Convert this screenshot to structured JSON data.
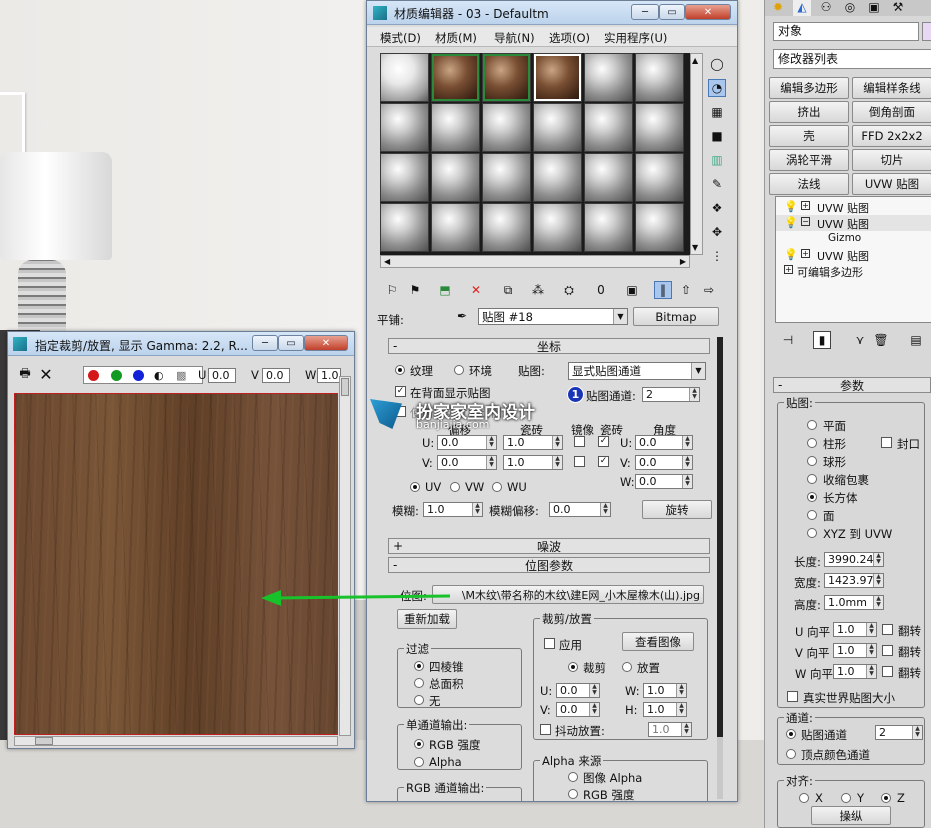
{
  "material_editor": {
    "title": "材质编辑器 - 03 - Defaultm",
    "menu": [
      "模式(D)",
      "材质(M)",
      "导航(N)",
      "选项(O)",
      "实用程序(U)"
    ],
    "tiling_label": "平铺:",
    "map_name": "贴图 #18",
    "map_type_button": "Bitmap",
    "coords": {
      "header": "坐标",
      "texture_label": "纹理",
      "environ_label": "环境",
      "mapping_label": "贴图:",
      "mapping_value": "显式贴图通道",
      "show_on_back": "在背面显示贴图",
      "map_channel_label": "贴图通道:",
      "map_channel_value": "2",
      "use_real_world": "使用真实世界比例",
      "offset_label": "偏移",
      "tiling_col": "瓷砖",
      "mirror_col": "镜像",
      "tile_col": "瓷砖",
      "angle_col": "角度",
      "u_label": "U:",
      "v_label": "V:",
      "w_label": "W:",
      "u_offset": "0.0",
      "v_offset": "0.0",
      "u_tiling": "1.0",
      "v_tiling": "1.0",
      "u_angle": "0.0",
      "v_angle": "0.0",
      "w_angle": "0.0",
      "uv": "UV",
      "vw": "VW",
      "wu": "WU",
      "blur_label": "模糊:",
      "blur_value": "1.0",
      "blur_offset_label": "模糊偏移:",
      "blur_offset_value": "0.0",
      "rotate_button": "旋转"
    },
    "noise_header": "噪波",
    "bitmap_params": {
      "header": "位图参数",
      "bitmap_label": "位图:",
      "bitmap_path": "\\M木纹\\带名称的木纹\\建E网_小木屋橡木(山).jpg",
      "reload_button": "重新加载",
      "crop_group": "裁剪/放置",
      "apply_label": "应用",
      "view_image_button": "查看图像",
      "crop_label": "裁剪",
      "place_label": "放置",
      "u_value": "0.0",
      "v_value": "0.0",
      "w_value": "1.0",
      "h_value": "1.0",
      "w_label": "W:",
      "h_label": "H:",
      "jitter_label": "抖动放置:",
      "jitter_value": "1.0",
      "filter_group": "过滤",
      "filter_pyramid": "四棱锥",
      "filter_sat": "总面积",
      "filter_none": "无",
      "mono_group": "单通道输出:",
      "rgb_intensity": "RGB 强度",
      "alpha": "Alpha",
      "rgb_group": "RGB 通道输出:",
      "alpha_group": "Alpha 来源",
      "image_alpha": "图像 Alpha",
      "rgb_intensity2": "RGB 强度"
    }
  },
  "crop_window": {
    "title": "指定裁剪/放置, 显示 Gamma: 2.2, R...",
    "u_label": "U",
    "v_label": "V",
    "w_label": "W",
    "u_value": "0.0",
    "v_value": "0.0",
    "w_value": "1.0"
  },
  "watermark": {
    "text": "扮家家室内设计",
    "url": "banjiajia.com"
  },
  "command_panel": {
    "object_label": "对象",
    "modifier_list": "修改器列表",
    "buttons": [
      "编辑多边形",
      "编辑样条线",
      "挤出",
      "倒角剖面",
      "壳",
      "FFD 2x2x2",
      "涡轮平滑",
      "切片",
      "法线",
      "UVW 贴图"
    ],
    "stack": [
      "UVW 贴图",
      "UVW 贴图",
      "Gizmo",
      "UVW 贴图",
      "可编辑多边形"
    ],
    "params_header": "参数",
    "mapping_group": "贴图:",
    "mapping_options": [
      "平面",
      "柱形",
      "球形",
      "收缩包裹",
      "长方体",
      "面",
      "XYZ 到 UVW"
    ],
    "cap_label": "封口",
    "length_label": "长度:",
    "length_value": "3990.24",
    "width_label": "宽度:",
    "width_value": "1423.97",
    "height_label": "高度:",
    "height_value": "1.0mm",
    "u_tile_label": "U 向平",
    "v_tile_label": "V 向平",
    "w_tile_label": "W 向平",
    "u_tile": "1.0",
    "v_tile": "1.0",
    "w_tile": "1.0",
    "flip_label": "翻转",
    "real_world_label": "真实世界贴图大小",
    "channel_group": "通道:",
    "map_channel_label": "贴图通道",
    "map_channel_value": "2",
    "vertex_color_label": "顶点颜色通道",
    "align_group": "对齐:",
    "x": "X",
    "y": "Y",
    "z": "Z",
    "manipulate_button": "操纵"
  },
  "badges": [
    "1",
    "2",
    "3"
  ],
  "colors": {
    "arrow": "#18c22a",
    "badge": "#1a34b8",
    "wood": "#6b4a2f",
    "panel": "#dcdcdc"
  }
}
